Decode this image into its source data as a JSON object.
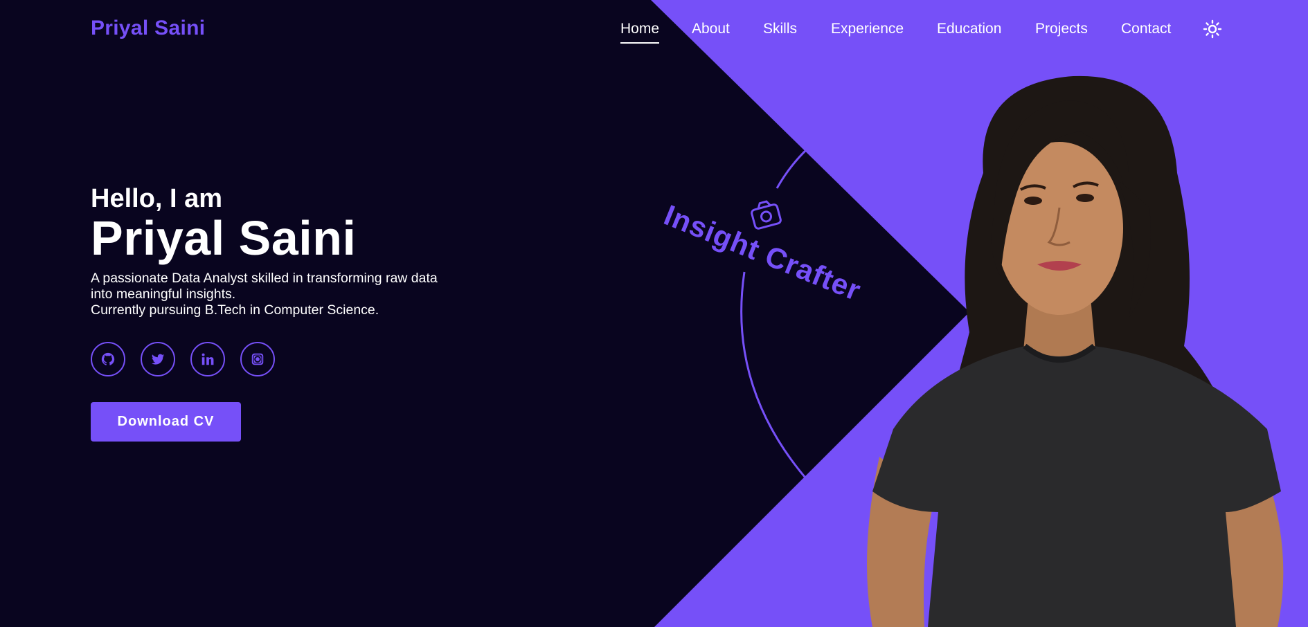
{
  "header": {
    "logo": "Priyal Saini",
    "nav": [
      {
        "label": "Home",
        "active": true
      },
      {
        "label": "About",
        "active": false
      },
      {
        "label": "Skills",
        "active": false
      },
      {
        "label": "Experience",
        "active": false
      },
      {
        "label": "Education",
        "active": false
      },
      {
        "label": "Projects",
        "active": false
      },
      {
        "label": "Contact",
        "active": false
      }
    ],
    "theme_icon": "sun-icon"
  },
  "hero": {
    "greeting": "Hello, I am",
    "name": "Priyal Saini",
    "description_line1": "A passionate Data Analyst skilled in transforming raw data",
    "description_line2": "into meaningful insights.",
    "description_line3": "Currently pursuing B.Tech in Computer Science.",
    "socials": [
      {
        "icon": "github-icon"
      },
      {
        "icon": "twitter-icon"
      },
      {
        "icon": "linkedin-icon"
      },
      {
        "icon": "instagram-icon"
      }
    ],
    "cv_button": "Download CV"
  },
  "decor": {
    "badge_text": "Insight Crafter",
    "badge_icon": "camera-icon"
  },
  "colors": {
    "background": "#09051f",
    "accent": "#7650f8",
    "text": "#ffffff"
  }
}
